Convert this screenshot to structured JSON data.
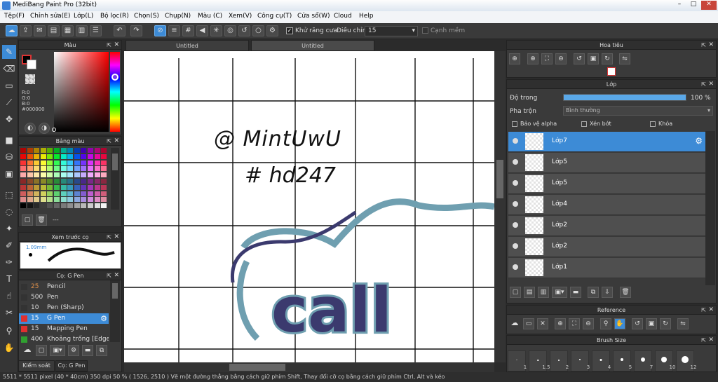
{
  "window": {
    "title": "MediBang Paint Pro (32bit)"
  },
  "menu": [
    "Tệp(F)",
    "Chỉnh sửa(E)",
    "Lớp(L)",
    "Bộ lọc(R)",
    "Chọn(S)",
    "Chụp(N)",
    "Màu (C)",
    "Xem(V)",
    "Công cụ(T)",
    "Cửa sổ(W)",
    "Cloud",
    "Help"
  ],
  "toolbar": {
    "antialias_label": "Khử răng cưa",
    "correction_label": "Điều chỉnh",
    "correction_value": "15",
    "snap_label": "Cạnh mềm"
  },
  "tabs": [
    "Untitled",
    "Untitled"
  ],
  "color_panel": {
    "title": "Màu",
    "r": "R:0",
    "g": "G:0",
    "b": "B:0",
    "hex": "#000000"
  },
  "palette_panel": {
    "title": "Bảng màu",
    "dash": "---"
  },
  "preview_panel": {
    "title": "Xem trước cọ",
    "size": "1.09mm"
  },
  "brush_panel": {
    "title": "Cọ: G Pen",
    "brushes": [
      {
        "size": "25",
        "name": "Pencil",
        "color": "#333333"
      },
      {
        "size": "500",
        "name": "Pen",
        "color": "#333333"
      },
      {
        "size": "10",
        "name": "Pen (Sharp)",
        "color": "#333333"
      },
      {
        "size": "15",
        "name": "G Pen",
        "color": "#e03030"
      },
      {
        "size": "15",
        "name": "Mapping Pen",
        "color": "#e03030"
      },
      {
        "size": "400",
        "name": "Khoảng trống [Edge]",
        "color": "#30a030"
      }
    ]
  },
  "bottom_tabs": [
    "Kiểm soát cọ",
    "Cọ: G Pen"
  ],
  "navigator": {
    "title": "Hoa tiêu"
  },
  "layers_panel": {
    "title": "Lớp",
    "opacity_label": "Độ trong",
    "opacity_value": "100 %",
    "opacity_pct": 100,
    "blend_label": "Pha trộn",
    "blend_value": "Bình thường",
    "protect_alpha": "Bảo vệ alpha",
    "clipping": "Xén bớt",
    "lock": "Khóa"
  },
  "layers": [
    "Lớp7",
    "Lớp5",
    "Lớp5",
    "Lớp4",
    "Lớp2",
    "Lớp2",
    "Lớp1"
  ],
  "reference_panel": {
    "title": "Reference"
  },
  "brushsize_panel": {
    "title": "Brush Size",
    "sizes": [
      "1",
      "1.5",
      "2",
      "3",
      "4",
      "5",
      "7",
      "10",
      "12"
    ]
  },
  "canvas_text": {
    "line1": "@ MintUwU",
    "line2": "# hd247"
  },
  "status": "5511 * 5511 pixel  (40 * 40cm)  350 dpi  50 %  ( 1526, 2510 )  Vẽ một đường thẳng bằng cách giữ phím Shift, Thay đổi cỡ cọ bằng cách giữ phím Ctrl, Alt và kéo",
  "colors": {
    "accent": "#3d8bd6",
    "bg": "#3a3a3a"
  }
}
